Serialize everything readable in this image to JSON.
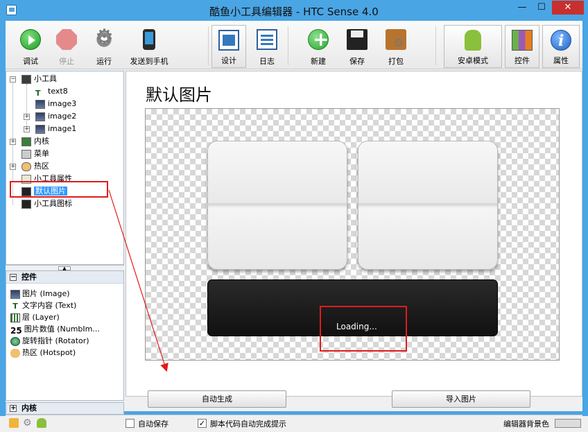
{
  "window": {
    "title": "酷鱼小工具编辑器 - HTC Sense 4.0",
    "minimize": "—",
    "maximize": "☐",
    "close": "✕"
  },
  "toolbar": {
    "debug": "调试",
    "stop": "停止",
    "run": "运行",
    "send_to_phone": "发送到手机",
    "design": "设计",
    "log": "日志",
    "new": "新建",
    "save": "保存",
    "pack": "打包",
    "android_mode": "安卓模式",
    "controls": "控件",
    "properties": "属性"
  },
  "tree": {
    "root": "小工具",
    "text8": "text8",
    "image3": "image3",
    "image2": "image2",
    "image1": "image1",
    "kernel": "内核",
    "menu": "菜单",
    "hotspot": "热区",
    "widget_props": "小工具属性",
    "default_image": "默认图片",
    "widget_icon": "小工具图标"
  },
  "controls_panel": {
    "header": "控件",
    "items": [
      "图片 (Image)",
      "文字内容 (Text)",
      "层 (Layer)",
      "图片数值 (NumbIm...",
      "旋转指针 (Rotator)",
      "热区 (Hotspot)"
    ],
    "kernel_header": "内核",
    "numb_prefix": "25"
  },
  "main": {
    "page_title": "默认图片",
    "loading_text": "Loading...",
    "auto_generate": "自动生成",
    "import_image": "导入图片"
  },
  "statusbar": {
    "auto_save": "自动保存",
    "auto_save_checked": false,
    "script_autocomplete": "脚本代码自动完成提示",
    "script_autocomplete_checked": true,
    "bg_color_label": "编辑器背景色"
  },
  "colors": {
    "titlebar": "#4aa5e4",
    "close_button": "#c7302f",
    "selection": "#3399ff",
    "annotation_red": "#e01b1b"
  }
}
